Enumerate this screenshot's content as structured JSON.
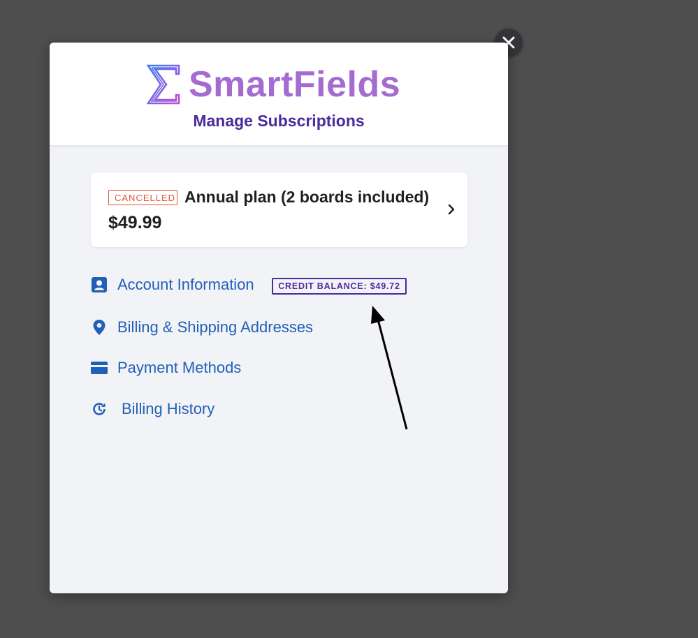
{
  "brand": {
    "name": "SmartFields",
    "logo_symbol": "Σ",
    "logo_colors": [
      "#3d7cf0",
      "#c14bd6"
    ],
    "name_color": "#a46bd0"
  },
  "portal": {
    "title": "Manage Subscriptions"
  },
  "close": {
    "icon": "close-icon"
  },
  "subscription": {
    "status": "CANCELLED",
    "plan": "Annual plan (2 boards included)",
    "price": "$49.99",
    "status_color": "#e0552e"
  },
  "nav": {
    "items": [
      {
        "label": "Account Information",
        "icon": "account-icon"
      },
      {
        "label": "Billing & Shipping Addresses",
        "icon": "location-pin-icon"
      },
      {
        "label": "Payment Methods",
        "icon": "credit-card-icon"
      },
      {
        "label": "Billing History",
        "icon": "history-icon"
      }
    ],
    "credit_badge": "CREDIT BALANCE: $49.72",
    "link_color": "#2160b8"
  },
  "annotation": {
    "type": "arrow",
    "points_to": "credit_badge",
    "color": "#000000"
  }
}
